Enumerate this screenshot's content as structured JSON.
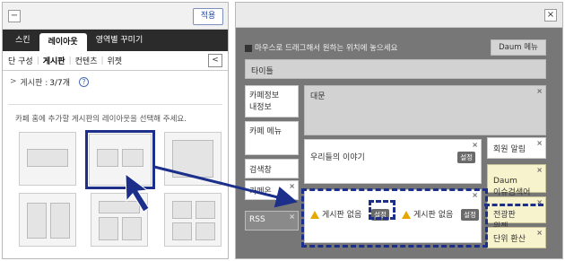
{
  "left_panel": {
    "apply_label": "적용",
    "tabs": [
      {
        "label": "스킨"
      },
      {
        "label": "레이아웃"
      },
      {
        "label": "영역별 꾸미기"
      }
    ],
    "subtabs": [
      {
        "label": "단 구성"
      },
      {
        "label": "게시판"
      },
      {
        "label": "컨텐츠"
      },
      {
        "label": "위젯"
      }
    ],
    "board_count_label": "게시판 :",
    "board_count_value": "3/7개",
    "help_symbol": "?",
    "description": "카페 홈에 추가할 게시판의 레이아웃을 선택해 주세요.",
    "back_arrow": "<"
  },
  "right_panel": {
    "close_symbol": "×",
    "hint": "마우스로 드래그해서 원하는 위치에 놓으세요",
    "daum_menu": "Daum 메뉴",
    "title_block": "타이틀",
    "side_items": [
      {
        "label": "카페정보\n내정보"
      },
      {
        "label": "카페 메뉴"
      },
      {
        "label": "검색창"
      },
      {
        "label": "카페온"
      },
      {
        "label": "RSS"
      }
    ],
    "main_block": "대문",
    "story_block": "우리들의 이야기",
    "settings_label": "설정",
    "no_board_label": "게시판 없음",
    "right_items": [
      {
        "label": "회원 알림"
      },
      {
        "label": "Daum\n이슈검색어"
      },
      {
        "label": "전광판\n위젯"
      },
      {
        "label": "단위 환산"
      }
    ],
    "close_x": "×"
  }
}
